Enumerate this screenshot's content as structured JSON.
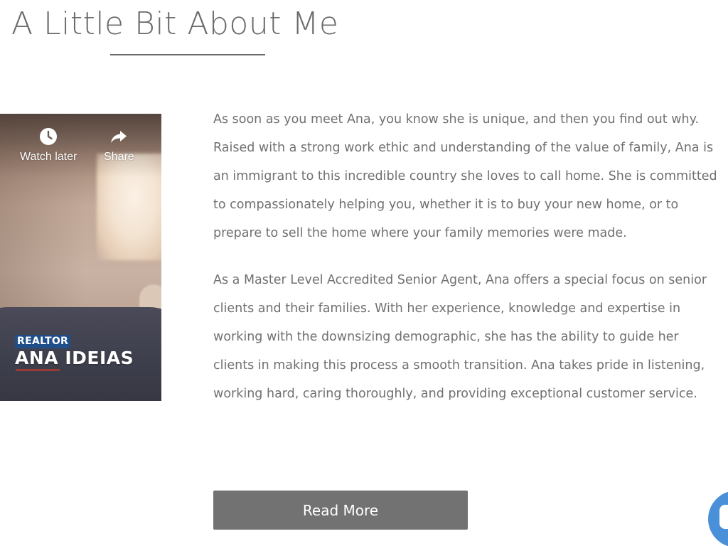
{
  "section": {
    "title": "A Little Bit About Me"
  },
  "video": {
    "watch_later_label": "Watch later",
    "share_label": "Share",
    "overlay_tag": "REALTOR",
    "overlay_name": "ANA IDEIAS"
  },
  "bio": {
    "paragraphs": [
      "As soon as you meet Ana, you know she is unique, and then you find out why. Raised with a strong work ethic and understanding of the value of family, Ana is an immigrant to this incredible country she loves to call home. She is committed to compassionately helping you, whether it is to buy your new home, or to prepare to sell the home where your family memories were made.",
      "As a Master Level Accredited Senior Agent, Ana offers a special focus on senior clients and their families. With her experience, knowledge and expertise in working with the downsizing demographic, she has the ability to guide her clients in making this process a smooth transition. Ana takes pride in listening, working hard, caring thoroughly, and providing exceptional customer service."
    ]
  },
  "actions": {
    "read_more_label": "Read More"
  },
  "icons": {
    "watch_later": "clock-icon",
    "share": "share-arrow-icon",
    "chat": "chat-bubble-icon"
  },
  "colors": {
    "title_text": "#6b6b6b",
    "body_text": "#707070",
    "button_bg": "#727272",
    "chat_widget": "#4a90d9",
    "realtor_tag_bg": "#1f4f8a"
  }
}
